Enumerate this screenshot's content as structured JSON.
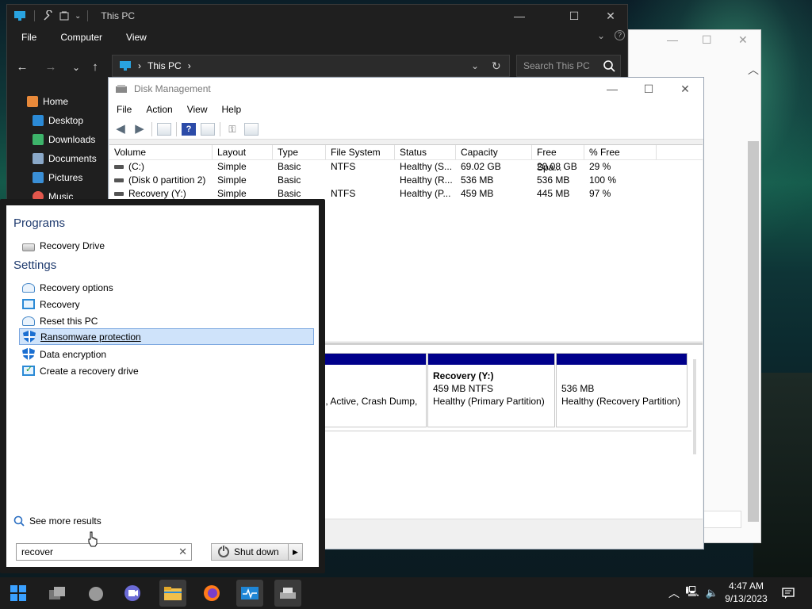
{
  "explorer": {
    "title": "This PC",
    "menu": [
      "File",
      "Computer",
      "View"
    ],
    "address": "This PC",
    "search_placeholder": "Search This PC",
    "nav": [
      "Home",
      "Desktop",
      "Downloads",
      "Documents",
      "Pictures",
      "Music"
    ]
  },
  "diskmgmt": {
    "title": "Disk Management",
    "menu": [
      "File",
      "Action",
      "View",
      "Help"
    ],
    "columns": [
      "Volume",
      "Layout",
      "Type",
      "File System",
      "Status",
      "Capacity",
      "Free Spa...",
      "% Free"
    ],
    "rows": [
      [
        "(C:)",
        "Simple",
        "Basic",
        "NTFS",
        "Healthy (S...",
        "69.02 GB",
        "20.08 GB",
        "29 %"
      ],
      [
        "(Disk 0 partition 2)",
        "Simple",
        "Basic",
        "",
        "Healthy (R...",
        "536 MB",
        "536 MB",
        "100 %"
      ],
      [
        "Recovery (Y:)",
        "Simple",
        "Basic",
        "NTFS",
        "Healthy (P...",
        "459 MB",
        "445 MB",
        "97 %"
      ]
    ],
    "partitions": [
      {
        "line1": "",
        "line2": "",
        "line3": "le, Active, Crash Dump,"
      },
      {
        "line1": "Recovery  (Y:)",
        "line2": "459 MB NTFS",
        "line3": "Healthy (Primary Partition)"
      },
      {
        "line1": "",
        "line2": "536 MB",
        "line3": "Healthy (Recovery Partition)"
      }
    ]
  },
  "startmenu": {
    "programs_header": "Programs",
    "programs": [
      "Recovery Drive"
    ],
    "settings_header": "Settings",
    "settings": [
      "Recovery options",
      "Recovery",
      "Reset this PC",
      "Ransomware protection",
      "Data encryption",
      "Create a recovery drive"
    ],
    "see_more": "See more results",
    "search_value": "recover",
    "shutdown_label": "Shut down"
  },
  "taskbar": {
    "time": "4:47 AM",
    "date": "9/13/2023"
  },
  "colors": {
    "accent": "#1b6fd1",
    "partition_band": "#00008b",
    "highlight": "#cfe3fa"
  }
}
